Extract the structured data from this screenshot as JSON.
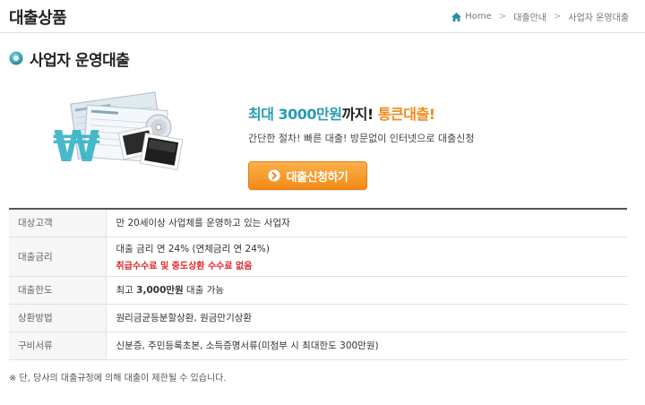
{
  "header": {
    "title": "대출상품",
    "breadcrumb": [
      "Home",
      "대출안내",
      "사업자 운영대출"
    ]
  },
  "section": {
    "title": "사업자 운영대출"
  },
  "promo": {
    "headline_part1": "최대 3000만원",
    "headline_part2": "까지!",
    "headline_part3": "통큰대출!",
    "subtitle": "간단한 절차! 빠른 대출! 방문없이 인터넷으로 대출신청",
    "apply_label": "대출신청하기"
  },
  "table": {
    "rows": [
      {
        "label": "대상고객",
        "value": "만 20세이상 사업체를 운영하고 있는 사업자"
      },
      {
        "label": "대출금리",
        "value": "대출 금리 연 24% (연체금리 연 24%)",
        "note": "취급수수료 및 중도상환 수수료 없음"
      },
      {
        "label": "대출한도",
        "value_pre": "최고 ",
        "value_bold": "3,000만원",
        "value_post": " 대출 가능"
      },
      {
        "label": "상환방법",
        "value": "원리금균등분할상환, 원금만기상환"
      },
      {
        "label": "구비서류",
        "value": "신분증, 주민등록초본, 소득증명서류(미첨부 시 최대한도 300만원)"
      }
    ]
  },
  "footnote": "※ 단, 당사의 대출규정에 의해 대출이 제한될 수 있습니다.",
  "colors": {
    "accent_teal": "#2a9bb3",
    "accent_orange": "#f08a1c",
    "note_red": "#e0262a"
  },
  "icons": [
    "home-icon",
    "section-bullet-icon",
    "arrow-right-circle-icon"
  ]
}
